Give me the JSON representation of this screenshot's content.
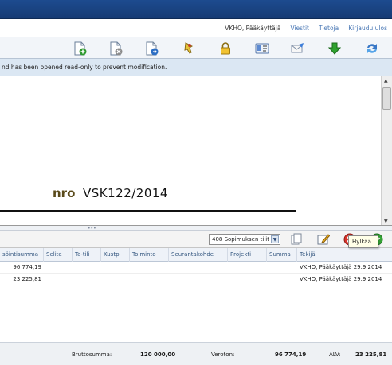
{
  "header": {
    "user": "VKHO, Pääkäyttäjä",
    "links": [
      "Viestit",
      "Tietoja",
      "Kirjaudu ulos"
    ]
  },
  "toolbar": {
    "icons": [
      "new-document-icon",
      "delete-document-icon",
      "copy-document-icon",
      "pin-icon",
      "lock-icon",
      "id-card-icon",
      "send-email-icon",
      "download-icon",
      "sync-icon"
    ]
  },
  "info": {
    "message": "nd has been opened read-only to prevent modification."
  },
  "document": {
    "nro_label": "nro",
    "number": "VSK122/2014"
  },
  "gridbar": {
    "account_select": "408 Sopimuksen tilit",
    "tooltip": "Hylkää"
  },
  "table": {
    "columns": [
      "söintisumma",
      "Selite",
      "Ta-tili",
      "Kustp",
      "Toiminto",
      "Seurantakohde",
      "Projekti",
      "Summa",
      "Tekijä"
    ],
    "rows": [
      {
        "amount": "96 774,19",
        "author": "VKHO, Pääkäyttäjä 29.9.2014"
      },
      {
        "amount": "23 225,81",
        "author": "VKHO, Pääkäyttäjä 29.9.2014"
      }
    ]
  },
  "footer": {
    "gross_label": "Bruttosumma:",
    "gross_value": "120 000,00",
    "net_label": "Veroton:",
    "net_value": "96 774,19",
    "vat_label": "ALV:",
    "vat_value": "23 225,81"
  }
}
